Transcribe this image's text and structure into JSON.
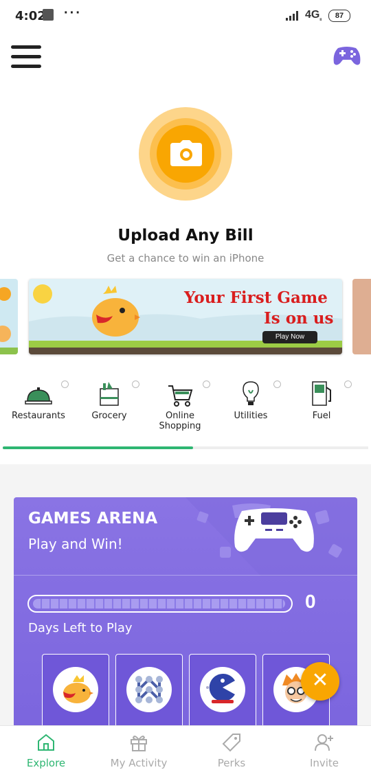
{
  "status_bar": {
    "time": "4:02",
    "dots": "···",
    "network": "4G",
    "network_sub": "ₗₗ",
    "battery": "87"
  },
  "colors": {
    "accent_green": "#2eb672",
    "camera_orange": "#f9a602",
    "arena_purple": "#7b65de"
  },
  "hero": {
    "title": "Upload Any Bill",
    "subtitle": "Get a chance to win an iPhone"
  },
  "banner": {
    "title_line1": "Your First Game",
    "title_line2": "Is on us",
    "button": "Play Now"
  },
  "categories": [
    {
      "label": "Restaurants",
      "icon": "cloche-icon"
    },
    {
      "label": "Grocery",
      "icon": "grocery-bag-icon"
    },
    {
      "label": "Online Shopping",
      "icon": "cart-icon"
    },
    {
      "label": "Utilities",
      "icon": "bulb-icon"
    },
    {
      "label": "Fuel",
      "icon": "fuel-pump-icon"
    }
  ],
  "carousel_scroll_fraction": 0.52,
  "games_arena": {
    "title": "GAMES ARENA",
    "subtitle": "Play and Win!",
    "count": "0",
    "progress_fraction": 1.0,
    "days_label": "Days Left to Play",
    "games": [
      "bird-game-icon",
      "connect-dots-game-icon",
      "pacman-game-icon",
      "professor-game-icon"
    ]
  },
  "fab": {
    "symbol": "✕"
  },
  "bottom_nav": [
    {
      "label": "Explore",
      "icon": "home-icon",
      "active": true
    },
    {
      "label": "My Activity",
      "icon": "gift-icon",
      "active": false
    },
    {
      "label": "Perks",
      "icon": "tag-icon",
      "active": false
    },
    {
      "label": "Invite",
      "icon": "add-user-icon",
      "active": false
    }
  ]
}
